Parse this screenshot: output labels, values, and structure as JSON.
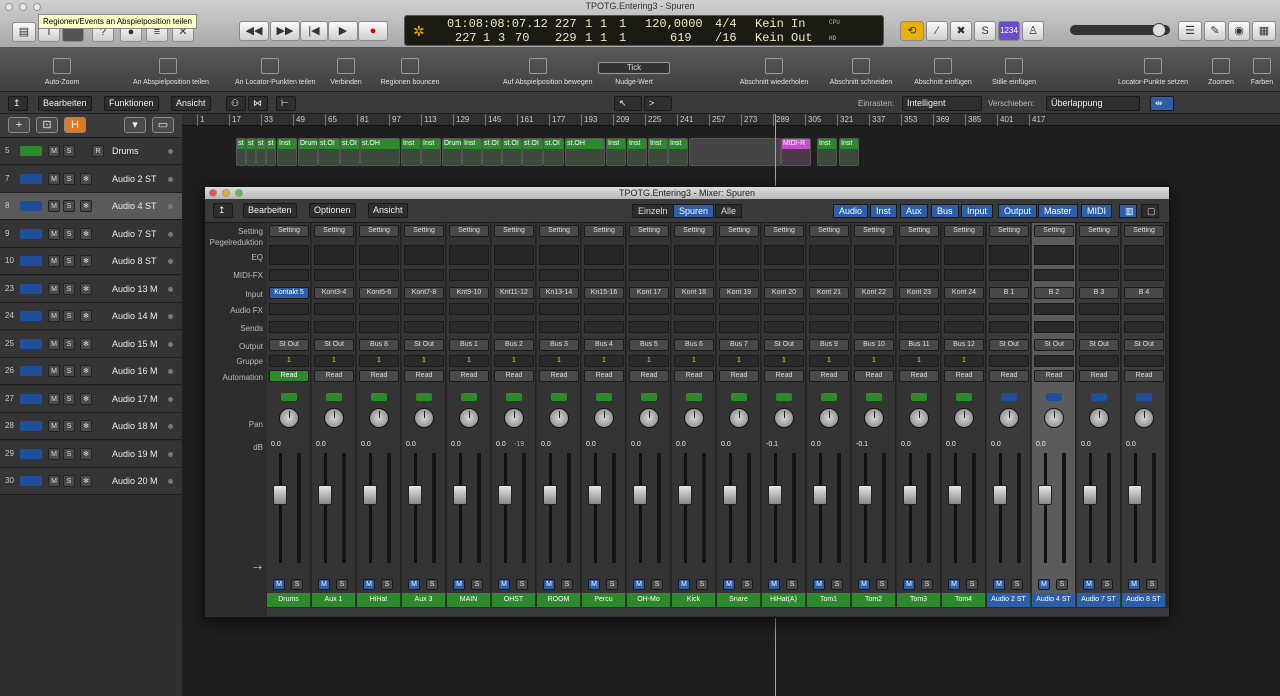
{
  "window": {
    "title": "TPOTG.Entering3 - Spuren",
    "tooltip": "Regionen/Events an Abspielposition teilen"
  },
  "lcd": {
    "position_smpte": "01:08:08:07.12",
    "bar1": "227",
    "beat1": "1",
    "div1": "1",
    "tick1": "1",
    "bar2": "227",
    "beat2": "1",
    "div2": "3",
    "tick2": "70",
    "end_bar": "229",
    "end_beat": "1",
    "end_div": "1",
    "end_tick": "1",
    "tempo": "120,0000",
    "signature": "4/4",
    "keyin": "Kein In",
    "tick_val": "619",
    "division": "/16",
    "keyout": "Kein Out",
    "cpu": "CPU",
    "hd": "HD"
  },
  "toolbar": {
    "counter": "1234",
    "controls": [
      "Auto-Zoom",
      "An Abspielposition teilen",
      "An Locator-Punkten teilen",
      "Verbinden",
      "Regionen bouncen",
      "Auf Abspielposition bewegen",
      "Nudge-Wert",
      "Abschnitt wiederholen",
      "Abschnitt schneiden",
      "Abschnitt einfügen",
      "Stille einfügen",
      "Locator-Punkte setzen",
      "Zoomen",
      "Farben"
    ],
    "nudge_value": "Tick"
  },
  "menubar": {
    "edit": "Bearbeiten",
    "functions": "Funktionen",
    "view": "Ansicht",
    "snap_label": "Einrasten:",
    "snap_value": "Intelligent",
    "drag_label": "Verschieben:",
    "drag_value": "Überlappung"
  },
  "tracks": [
    {
      "num": "5",
      "name": "Drums",
      "type": "midi",
      "selected": false
    },
    {
      "num": "7",
      "name": "Audio 2 ST",
      "type": "audio",
      "selected": false
    },
    {
      "num": "8",
      "name": "Audio 4 ST",
      "type": "audio",
      "selected": true
    },
    {
      "num": "9",
      "name": "Audio 7 ST",
      "type": "audio",
      "selected": false
    },
    {
      "num": "10",
      "name": "Audio 8 ST",
      "type": "audio",
      "selected": false
    },
    {
      "num": "23",
      "name": "Audio 13 M",
      "type": "audio",
      "selected": false
    },
    {
      "num": "24",
      "name": "Audio 14 M",
      "type": "audio",
      "selected": false
    },
    {
      "num": "25",
      "name": "Audio 15 M",
      "type": "audio",
      "selected": false
    },
    {
      "num": "26",
      "name": "Audio 16 M",
      "type": "audio",
      "selected": false
    },
    {
      "num": "27",
      "name": "Audio 17 M",
      "type": "audio",
      "selected": false
    },
    {
      "num": "28",
      "name": "Audio 18 M",
      "type": "audio",
      "selected": false
    },
    {
      "num": "29",
      "name": "Audio 19 M",
      "type": "audio",
      "selected": false
    },
    {
      "num": "30",
      "name": "Audio 20 M",
      "type": "audio",
      "selected": false
    }
  ],
  "track_buttons": {
    "mute": "M",
    "solo": "S",
    "rec": "R"
  },
  "ruler": [
    "1",
    "17",
    "33",
    "49",
    "65",
    "81",
    "97",
    "113",
    "129",
    "145",
    "161",
    "177",
    "193",
    "209",
    "225",
    "241",
    "257",
    "273",
    "289",
    "305",
    "321",
    "337",
    "353",
    "369",
    "385",
    "401",
    "417"
  ],
  "regions": [
    "st",
    "st",
    "st",
    "st",
    "Inst",
    "Drum",
    "st.OI",
    "st.OI",
    "st.OH",
    "Inst",
    "Inst",
    "Drum",
    "Inst",
    "st.OI",
    "st.OI",
    "st.OI",
    "st.OI",
    "st.OH",
    "Inst",
    "Inst",
    "Inst",
    "Inst",
    "MIDI-R",
    "Inst",
    "Inst"
  ],
  "mixer": {
    "title": "TPOTG.Entering3 - Mixer: Spuren",
    "edit": "Bearbeiten",
    "options": "Optionen",
    "view": "Ansicht",
    "modes": [
      "Einzeln",
      "Spuren",
      "Alle"
    ],
    "filters": [
      "Audio",
      "Inst",
      "Aux",
      "Bus",
      "Input",
      "Output",
      "Master",
      "MIDI"
    ],
    "row_labels": {
      "setting": "Setting",
      "gain": "Pegelreduktion",
      "eq": "EQ",
      "midifx": "MIDI-FX",
      "input": "Input",
      "audiofx": "Audio FX",
      "sends": "Sends",
      "output": "Output",
      "group": "Gruppe",
      "automation": "Automation",
      "pan": "Pan",
      "db": "dB"
    },
    "strips": [
      {
        "name": "Drums",
        "input": "Kontakt 5",
        "output": "St Out",
        "group": "1",
        "auto": "Read",
        "vol": "0.0",
        "peak": "",
        "color": "green",
        "kind": "inst"
      },
      {
        "name": "Aux 1",
        "input": "Kont3-4",
        "output": "St Out",
        "group": "1",
        "auto": "Read",
        "vol": "0.0",
        "peak": "",
        "color": "green",
        "kind": "inst"
      },
      {
        "name": "HiHat",
        "input": "Kont5-6",
        "output": "Bus 8",
        "group": "1",
        "auto": "Read",
        "vol": "0.0",
        "peak": "",
        "color": "green",
        "kind": "inst"
      },
      {
        "name": "Aux 3",
        "input": "Kont7-8",
        "output": "St Out",
        "group": "1",
        "auto": "Read",
        "vol": "0.0",
        "peak": "",
        "color": "green",
        "kind": "inst"
      },
      {
        "name": "MAIN",
        "input": "Knt9-10",
        "output": "Bus 1",
        "group": "1",
        "auto": "Read",
        "vol": "0.0",
        "peak": "",
        "color": "green",
        "kind": "inst"
      },
      {
        "name": "OHST",
        "input": "Knt11-12",
        "output": "Bus 2",
        "group": "1",
        "auto": "Read",
        "vol": "0.0",
        "peak": "-19",
        "color": "green",
        "kind": "inst"
      },
      {
        "name": "ROOM",
        "input": "Kn13-14",
        "output": "Bus 3",
        "group": "1",
        "auto": "Read",
        "vol": "0.0",
        "peak": "",
        "color": "green",
        "kind": "inst"
      },
      {
        "name": "Percu",
        "input": "Kn15-16",
        "output": "Bus 4",
        "group": "1",
        "auto": "Read",
        "vol": "0.0",
        "peak": "",
        "color": "green",
        "kind": "inst"
      },
      {
        "name": "OH-Mo",
        "input": "Kont 17",
        "output": "Bus 5",
        "group": "1",
        "auto": "Read",
        "vol": "0.0",
        "peak": "",
        "color": "green",
        "kind": "inst"
      },
      {
        "name": "Kick",
        "input": "Kont 18",
        "output": "Bus 6",
        "group": "1",
        "auto": "Read",
        "vol": "0.0",
        "peak": "",
        "color": "green",
        "kind": "inst"
      },
      {
        "name": "Snare",
        "input": "Kont 19",
        "output": "Bus 7",
        "group": "1",
        "auto": "Read",
        "vol": "0.0",
        "peak": "",
        "color": "green",
        "kind": "inst"
      },
      {
        "name": "HiHat(A)",
        "input": "Kont 20",
        "output": "St Out",
        "group": "1",
        "auto": "Read",
        "vol": "-0.1",
        "peak": "",
        "color": "green",
        "kind": "inst"
      },
      {
        "name": "Tom1",
        "input": "Kont 21",
        "output": "Bus 9",
        "group": "1",
        "auto": "Read",
        "vol": "0.0",
        "peak": "",
        "color": "green",
        "kind": "inst"
      },
      {
        "name": "Tom2",
        "input": "Kont 22",
        "output": "Bus 10",
        "group": "1",
        "auto": "Read",
        "vol": "-0.1",
        "peak": "",
        "color": "green",
        "kind": "inst"
      },
      {
        "name": "Tom3",
        "input": "Kont 23",
        "output": "Bus 11",
        "group": "1",
        "auto": "Read",
        "vol": "0.0",
        "peak": "",
        "color": "green",
        "kind": "inst"
      },
      {
        "name": "Tom4",
        "input": "Kont 24",
        "output": "Bus 12",
        "group": "1",
        "auto": "Read",
        "vol": "0.0",
        "peak": "",
        "color": "green",
        "kind": "inst"
      },
      {
        "name": "Audio 2 ST",
        "input": "B 1",
        "output": "St Out",
        "group": "",
        "auto": "Read",
        "vol": "0.0",
        "peak": "",
        "color": "blue",
        "kind": "audio"
      },
      {
        "name": "Audio 4 ST",
        "input": "B 2",
        "output": "St Out",
        "group": "",
        "auto": "Read",
        "vol": "0.0",
        "peak": "",
        "color": "blue",
        "kind": "audio",
        "selected": true
      },
      {
        "name": "Audio 7 ST",
        "input": "B 3",
        "output": "St Out",
        "group": "",
        "auto": "Read",
        "vol": "0.0",
        "peak": "",
        "color": "blue",
        "kind": "audio"
      },
      {
        "name": "Audio 8 ST",
        "input": "B 4",
        "output": "St Out",
        "group": "",
        "auto": "Read",
        "vol": "0.0",
        "peak": "",
        "color": "blue",
        "kind": "audio"
      }
    ],
    "setting_label": "Setting"
  }
}
